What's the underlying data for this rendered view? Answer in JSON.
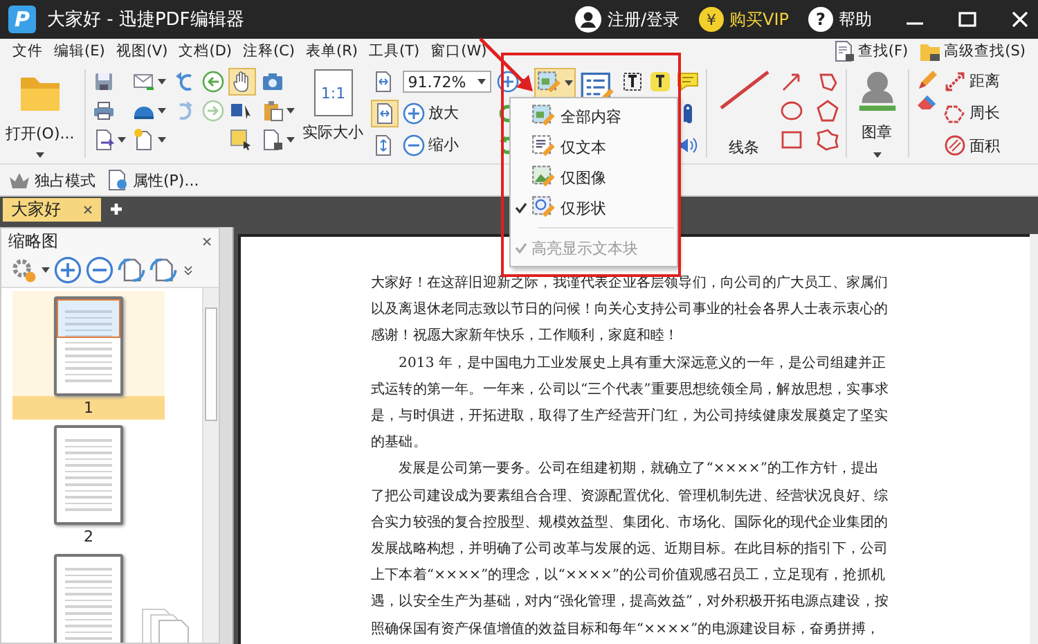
{
  "window": {
    "logo_letter": "P",
    "title": "大家好 - 迅捷PDF编辑器",
    "account": "注册/登录",
    "vip_coin": "¥",
    "vip": "购买VIP",
    "help_icon": "?",
    "help": "帮助"
  },
  "menu": {
    "items": [
      "文件",
      "编辑(E)",
      "视图(V)",
      "文档(D)",
      "注释(C)",
      "表单(R)",
      "工具(T)",
      "窗口(W)"
    ],
    "search": "查找(F)",
    "advanced_search": "高级查找(S)"
  },
  "ribbon": {
    "open": "打开(O)...",
    "zoom": "91.72%",
    "actual_size_badge": "1:1",
    "actual_size": "实际大小",
    "zoom_in": "放大",
    "zoom_out": "缩小",
    "line": "线条",
    "stamp": "图章",
    "distance": "距离",
    "perimeter": "周长",
    "area": "面积"
  },
  "subbar": {
    "exclusive_mode": "独占模式",
    "properties": "属性(P)..."
  },
  "tabs": [
    {
      "label": "大家好",
      "selected": true
    }
  ],
  "dropdown": {
    "items": [
      {
        "kind": "option",
        "label": "全部内容",
        "checked": false,
        "disabled": false
      },
      {
        "kind": "option",
        "label": "仅文本",
        "checked": false,
        "disabled": false
      },
      {
        "kind": "option",
        "label": "仅图像",
        "checked": false,
        "disabled": false
      },
      {
        "kind": "option",
        "label": "仅形状",
        "checked": true,
        "disabled": false
      },
      {
        "kind": "separator"
      },
      {
        "kind": "option",
        "label": "高亮显示文本块",
        "checked": true,
        "disabled": true
      }
    ]
  },
  "sidebar": {
    "title": "缩略图",
    "pages": [
      {
        "label": "1",
        "selected": true
      },
      {
        "label": "2",
        "selected": false
      },
      {
        "selected": false
      }
    ]
  },
  "document": {
    "paragraphs": [
      "大家好！在这辞旧迎新之际，我谨代表企业各层领导们，向公司的广大员工、家属们以及离退休老同志致以节日的问候！向关心支持公司事业的社会各界人士表示衷心的感谢！祝愿大家新年快乐，工作顺利，家庭和睦！",
      "2013 年，是中国电力工业发展史上具有重大深远意义的一年，是公司组建并正式运转的第一年。一年来，公司以“三个代表”重要思想统领全局，解放思想，实事求是，与时俱进，开拓进取，取得了生产经营开门红，为公司持续健康发展奠定了坚实的基础。",
      "发展是公司第一要务。公司在组建初期，就确立了“××××”的工作方针，提出了把公司建设成为要素组合合理、资源配置优化、管理机制先进、经营状况良好、综合实力较强的复合控股型、规模效益型、集团化、市场化、国际化的现代企业集团的发展战略构想，并明确了公司改革与发展的远、近期目标。在此目标的指引下，公司上下本着“××××”的理念，以“××××”的公司价值观感召员工，立足现有，抢抓机遇，以安全生产为基础，对内“强化管理，提高效益”，对外积极开拓电源点建设，按照确保国有资产保值增值的效益目标和每年“××××”的电源建设目标，奋勇拼搏，"
    ]
  }
}
